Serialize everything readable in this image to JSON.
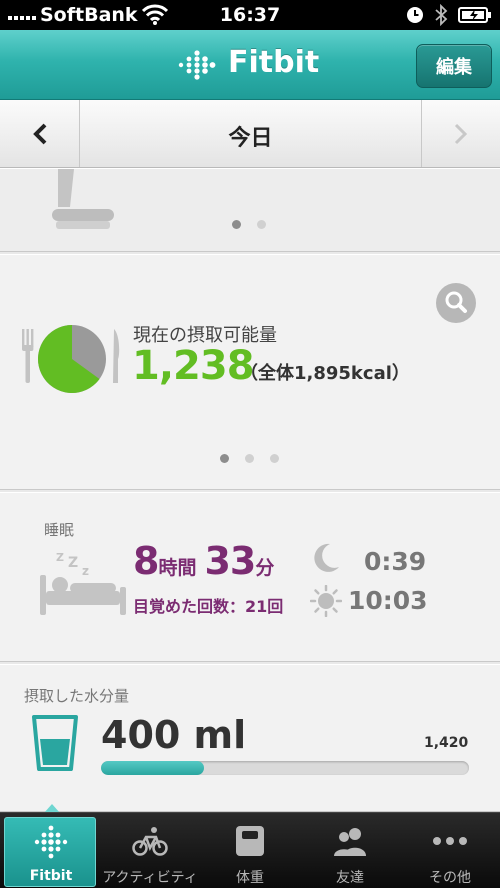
{
  "status_bar": {
    "carrier": "SoftBank",
    "time": "16:37",
    "icons": [
      "signal-icon",
      "wifi-icon",
      "alarm-icon",
      "bluetooth-icon",
      "battery-icon"
    ]
  },
  "header": {
    "title": "Fitbit",
    "edit_label": "編集"
  },
  "date_nav": {
    "prev_label": "‹",
    "day_label": "今日",
    "next_label": "›"
  },
  "weight_card": {
    "pager_total": 2,
    "pager_active": 0
  },
  "food_card": {
    "label": "現在の摂取可能量",
    "value": "1,238",
    "total_label": "（全体1,895kcal）",
    "remaining_fraction": 0.65,
    "colors": {
      "remaining": "#62bd23",
      "consumed": "#9a9a9a"
    },
    "pager_total": 3,
    "pager_active": 0
  },
  "sleep_card": {
    "label": "睡眠",
    "hours": "8",
    "hours_unit": "時間",
    "minutes": "33",
    "minutes_unit": "分",
    "awakened": "目覚めた回数：21回",
    "start_time": "0:39",
    "end_time": "10:03",
    "color": "#7b2c72"
  },
  "water_card": {
    "label": "摂取した水分量",
    "value": "400 ml",
    "goal": "1,420",
    "progress_fraction": 0.28,
    "color": "#2aa6a0"
  },
  "tab_bar": {
    "tabs": [
      {
        "label": "Fitbit",
        "icon": "fitbit-logo-icon",
        "active": true
      },
      {
        "label": "アクティビティ",
        "icon": "bicycle-icon",
        "active": false
      },
      {
        "label": "体重",
        "icon": "scale-icon",
        "active": false
      },
      {
        "label": "友達",
        "icon": "friends-icon",
        "active": false
      },
      {
        "label": "その他",
        "icon": "more-icon",
        "active": false
      }
    ]
  },
  "colors": {
    "brand": "#2fb3ad",
    "background": "#e9e9e9"
  }
}
